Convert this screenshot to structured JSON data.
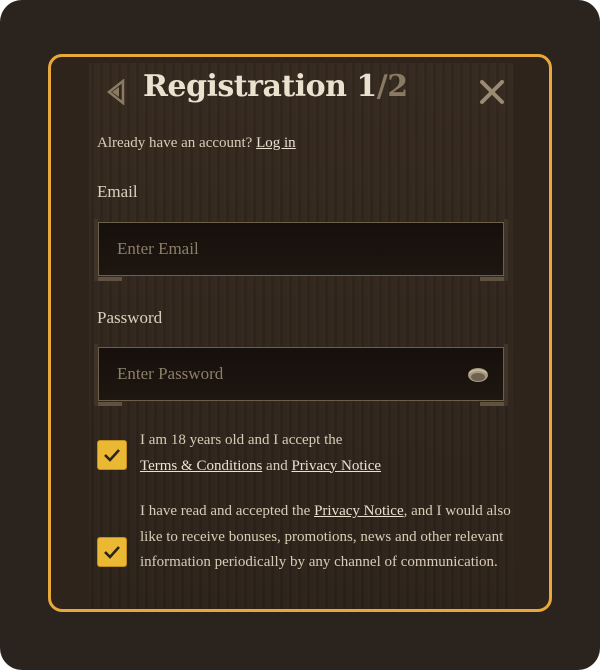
{
  "header": {
    "title_main": "Registration 1",
    "title_total": "/2"
  },
  "login_prompt": {
    "text": "Already have an account?",
    "link_label": "Log in"
  },
  "email": {
    "label": "Email",
    "placeholder": "Enter Email",
    "value": ""
  },
  "password": {
    "label": "Password",
    "placeholder": "Enter Password",
    "value": ""
  },
  "consents": [
    {
      "checked": true,
      "text_1": "I am 18 years old and I accept the",
      "link_terms": "Terms & Conditions",
      "text_and": "and",
      "link_privacy": "Privacy Notice"
    },
    {
      "checked": true,
      "text_1": "I have read and accepted the",
      "link_privacy": "Privacy Notice",
      "text_2": ", and I would also like to receive bonuses, promotions, news and other relevant information periodically by any channel of communication."
    }
  ],
  "colors": {
    "accent": "#e9a83a",
    "checkbox": "#eab832",
    "background": "#2b231d",
    "text": "#ebe1cf"
  },
  "icons": {
    "back": "triangle-left-icon",
    "close": "close-icon",
    "eye": "eye-icon",
    "check": "checkmark-icon"
  }
}
